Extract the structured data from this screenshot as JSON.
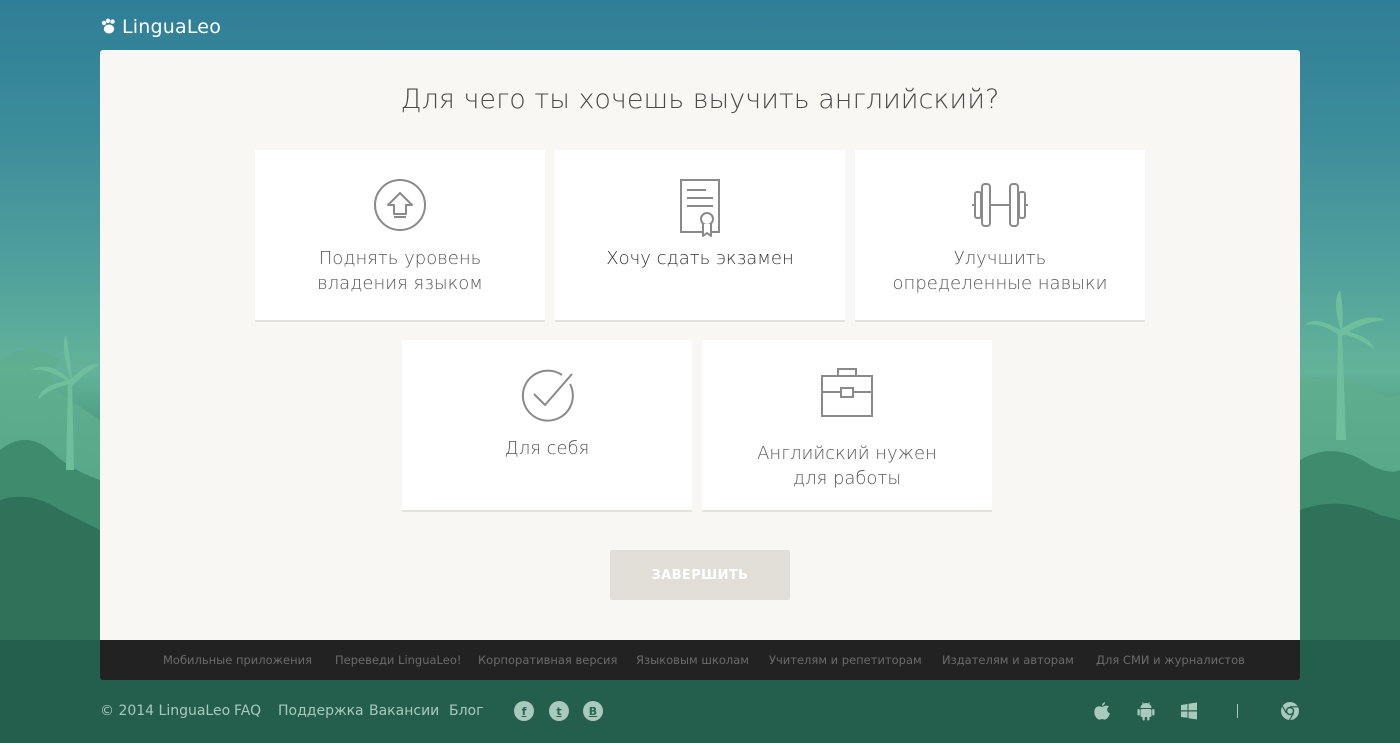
{
  "header": {
    "logo_text": "LinguaLeo"
  },
  "main": {
    "question": "Для чего ты хочешь выучить английский?",
    "options": [
      {
        "label": "Поднять уровень\nвладения языком",
        "icon": "arrow-up-circle-icon"
      },
      {
        "label": "Хочу сдать экзамен",
        "icon": "certificate-icon"
      },
      {
        "label": "Улучшить\nопределенные навыки",
        "icon": "dumbbell-icon"
      },
      {
        "label": "Для себя",
        "icon": "checkmark-circle-icon"
      },
      {
        "label": "Английский нужен\nдля работы",
        "icon": "briefcase-icon"
      }
    ],
    "finish_label": "ЗАВЕРШИТЬ"
  },
  "footer_links": [
    "Мобильные приложения",
    "Переведи LinguaLeo!",
    "Корпоративная версия",
    "Языковым школам",
    "Учителям и репетиторам",
    "Издателям и авторам",
    "Для СМИ и журналистов"
  ],
  "bottom": {
    "copyright": "© 2014 LinguaLeo",
    "links": [
      "FAQ",
      "Поддержка",
      "Вакансии",
      "Блог"
    ],
    "social": [
      {
        "name": "facebook-icon",
        "glyph": "f"
      },
      {
        "name": "twitter-icon",
        "glyph": "t"
      },
      {
        "name": "vk-icon",
        "glyph": "B"
      }
    ],
    "platforms": [
      "apple-icon",
      "android-icon",
      "windows-icon",
      "chrome-icon"
    ]
  },
  "colors": {
    "panel_bg": "#f8f7f3",
    "card_bg": "#ffffff",
    "button_disabled": "#e0ded7",
    "footer_bar": "#222222",
    "footer_text": "#a9c9bd"
  }
}
